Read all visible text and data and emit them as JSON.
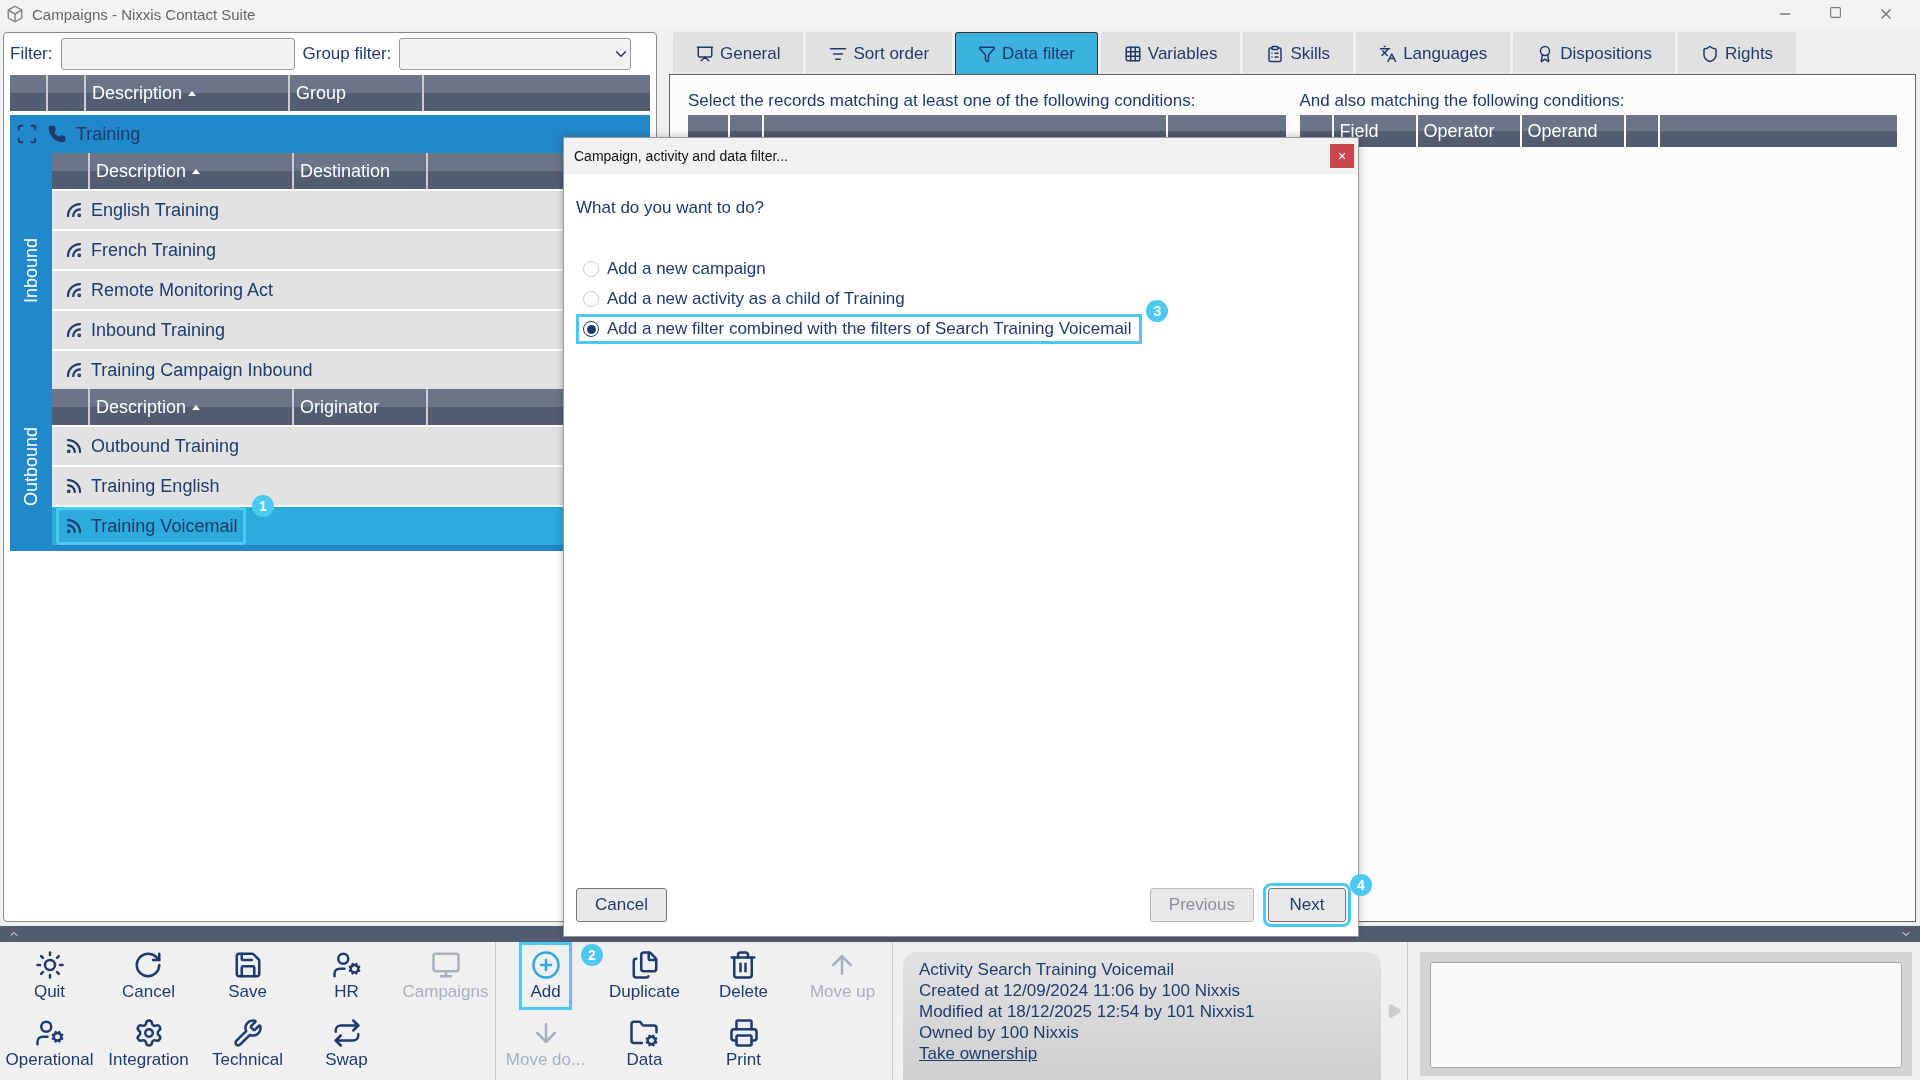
{
  "window": {
    "title": "Campaigns - Nixxis Contact Suite"
  },
  "filter_bar": {
    "filter_label": "Filter:",
    "group_filter_label": "Group filter:"
  },
  "campaign_grid": {
    "columns": [
      {
        "label": "Description",
        "sorted": true
      },
      {
        "label": "Group",
        "sorted": false
      }
    ]
  },
  "campaign": {
    "name": "Training",
    "selected": true
  },
  "sections": [
    {
      "label": "Inbound",
      "kind": "inbound",
      "columns": [
        {
          "label": "Description",
          "sorted": true
        },
        {
          "label": "Destination",
          "sorted": false
        }
      ],
      "rows": [
        {
          "name": "English Training",
          "selected": false
        },
        {
          "name": "French Training",
          "selected": false
        },
        {
          "name": "Remote Monitoring Act",
          "selected": false
        },
        {
          "name": "Inbound Training",
          "selected": false
        },
        {
          "name": "Training Campaign Inbound",
          "selected": false
        }
      ]
    },
    {
      "label": "Outbound",
      "kind": "outbound",
      "columns": [
        {
          "label": "Description",
          "sorted": true
        },
        {
          "label": "Originator",
          "sorted": false
        }
      ],
      "rows": [
        {
          "name": "Outbound Training",
          "selected": false
        },
        {
          "name": "Training English",
          "selected": false
        },
        {
          "name": "Training Voicemail",
          "selected": true,
          "callout": "1"
        }
      ]
    }
  ],
  "tabs": [
    {
      "label": "General",
      "selected": false
    },
    {
      "label": "Sort order",
      "selected": false
    },
    {
      "label": "Data filter",
      "selected": true
    },
    {
      "label": "Variables",
      "selected": false
    },
    {
      "label": "Skills",
      "selected": false
    },
    {
      "label": "Languages",
      "selected": false
    },
    {
      "label": "Dispositions",
      "selected": false
    },
    {
      "label": "Rights",
      "selected": false
    }
  ],
  "data_filter": {
    "any_conditions_label": "Select the records matching at least one of the following conditions:",
    "all_conditions_label": "And also matching the following conditions:",
    "all_conditions_columns": [
      "Field",
      "Operator",
      "Operand"
    ]
  },
  "dialog": {
    "title": "Campaign, activity and data filter...",
    "close": "×",
    "question": "What do you want to do?",
    "options": [
      {
        "label": "Add a new campaign",
        "selected": false
      },
      {
        "label": "Add a new activity as a child of Training",
        "selected": false
      },
      {
        "label": "Add a new filter combined with the filters of Search Training Voicemail",
        "selected": true,
        "callout": "3"
      }
    ],
    "buttons": [
      {
        "label": "Cancel",
        "disabled": false
      },
      {
        "label": "Previous",
        "disabled": true
      },
      {
        "label": "Next",
        "disabled": false,
        "callout": "4"
      }
    ]
  },
  "toolbar": {
    "groups": [
      {
        "buttons": [
          {
            "label": "Quit",
            "disabled": false
          },
          {
            "label": "Cancel",
            "disabled": false
          },
          {
            "label": "Save",
            "disabled": false
          },
          {
            "label": "HR",
            "disabled": false
          },
          {
            "label": "Campaigns",
            "disabled": true
          },
          {
            "label": "Operational",
            "disabled": false
          },
          {
            "label": "Integration",
            "disabled": false
          },
          {
            "label": "Technical",
            "disabled": false
          },
          {
            "label": "Swap",
            "disabled": false
          }
        ]
      },
      {
        "buttons": [
          {
            "label": "Add",
            "disabled": false,
            "callout": "2"
          },
          {
            "label": "Duplicate",
            "disabled": false
          },
          {
            "label": "Delete",
            "disabled": false
          },
          {
            "label": "Move up",
            "disabled": true
          },
          {
            "label": "Move do...",
            "disabled": true
          },
          {
            "label": "Data",
            "disabled": false
          },
          {
            "label": "Print",
            "disabled": false
          }
        ]
      }
    ]
  },
  "info": {
    "lines": [
      "Activity Search Training Voicemail",
      "Created at 12/09/2024 11:06 by 100 Nixxis",
      "Modified at 18/12/2025 12:54 by 101 Nixxis1",
      "Owned by 100 Nixxis"
    ],
    "link": "Take ownership"
  }
}
